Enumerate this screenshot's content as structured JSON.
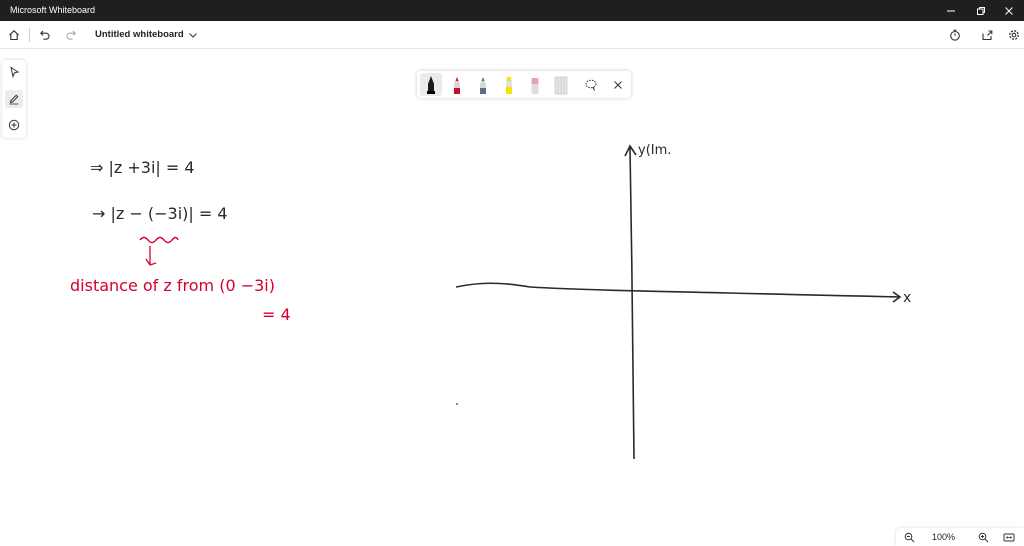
{
  "window": {
    "title": "Microsoft Whiteboard"
  },
  "appbar": {
    "board_name": "Untitled whiteboard"
  },
  "zoom": {
    "level": "100%"
  },
  "ink": {
    "black": [
      "⇒  |z +3i| = 4",
      "→  |z − (−3i)| = 4"
    ],
    "red": [
      "distance of  z  from  (0 −3i)",
      "= 4"
    ],
    "axis_y_label": "y(Im.",
    "axis_x_label": "x"
  },
  "colors": {
    "pen_black": "#1a1a1a",
    "pen_red": "#c8102e",
    "pen_blue": "#5a6e86",
    "pen_yellow": "#f2e600",
    "pen_pink": "#e8a3b0",
    "ink_red": "#d6002e",
    "ink_black": "#2a2a2a"
  }
}
